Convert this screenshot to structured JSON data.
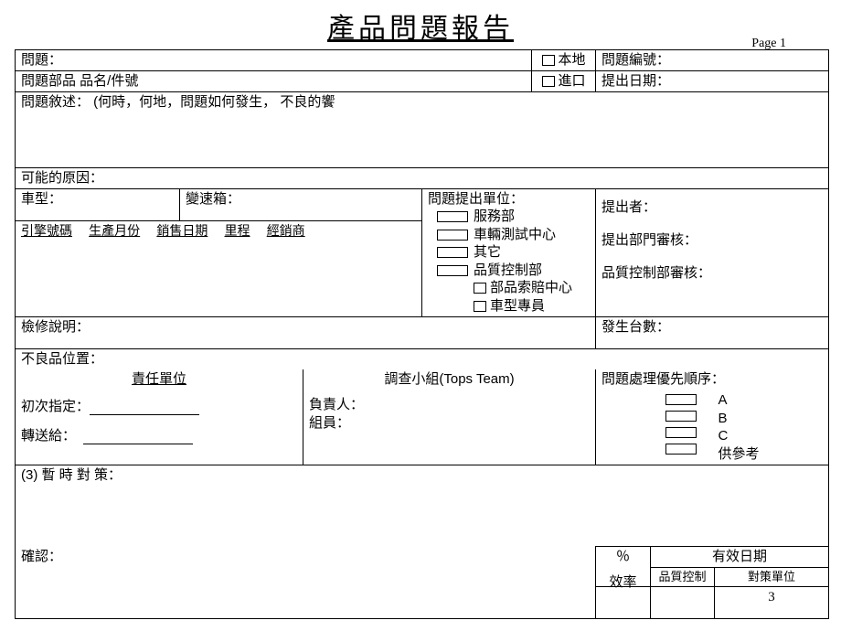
{
  "title": "產品問題報告",
  "page_label": "Page 1",
  "row1": {
    "issue": "問題：",
    "local": "本地",
    "issue_no": "問題編號："
  },
  "row2": {
    "part": "問題部品 品名/件號",
    "import": "進口",
    "submit_date": "提出日期："
  },
  "desc": "問題敘述： (何時，何地，問題如何發生， 不良的饗",
  "cause": "可能的原因：",
  "vehicle": {
    "model": "車型：",
    "trans": "變速箱：",
    "h_engine": "引擎號碼",
    "h_prod": "生產月份",
    "h_sale": "銷售日期",
    "h_mile": "里程",
    "h_dealer": "經銷商"
  },
  "reporting_unit": {
    "label": "問題提出單位：",
    "o1": "服務部",
    "o2": "車輛測試中心",
    "o3": "其它",
    "o4": "品質控制部",
    "o5": "部品索賠中心",
    "o6": "車型專員"
  },
  "right1": {
    "reporter": "提出者：",
    "dept_review": "提出部門審核：",
    "qc_review": "品質控制部審核："
  },
  "repair": "檢修說明：",
  "occurrence": "發生台數：",
  "defect_pos": "不良品位置：",
  "responsible": {
    "hdr": "責任單位",
    "first": "初次指定：",
    "forward": "轉送給："
  },
  "team": {
    "hdr": "調查小組(Tops Team)",
    "leader": "負責人：",
    "members": "組員："
  },
  "priority": {
    "hdr": "問題處理優先順序：",
    "a": "A",
    "b": "B",
    "c": "C",
    "ref": "供參考"
  },
  "temp_action": "(3) 暫 時 對 策：",
  "confirm": "確認：",
  "footer": {
    "pct": "％",
    "effic": "效率",
    "eff_date": "有效日期",
    "qc": "品質控制",
    "counter_unit": "對策單位",
    "num": "3"
  }
}
